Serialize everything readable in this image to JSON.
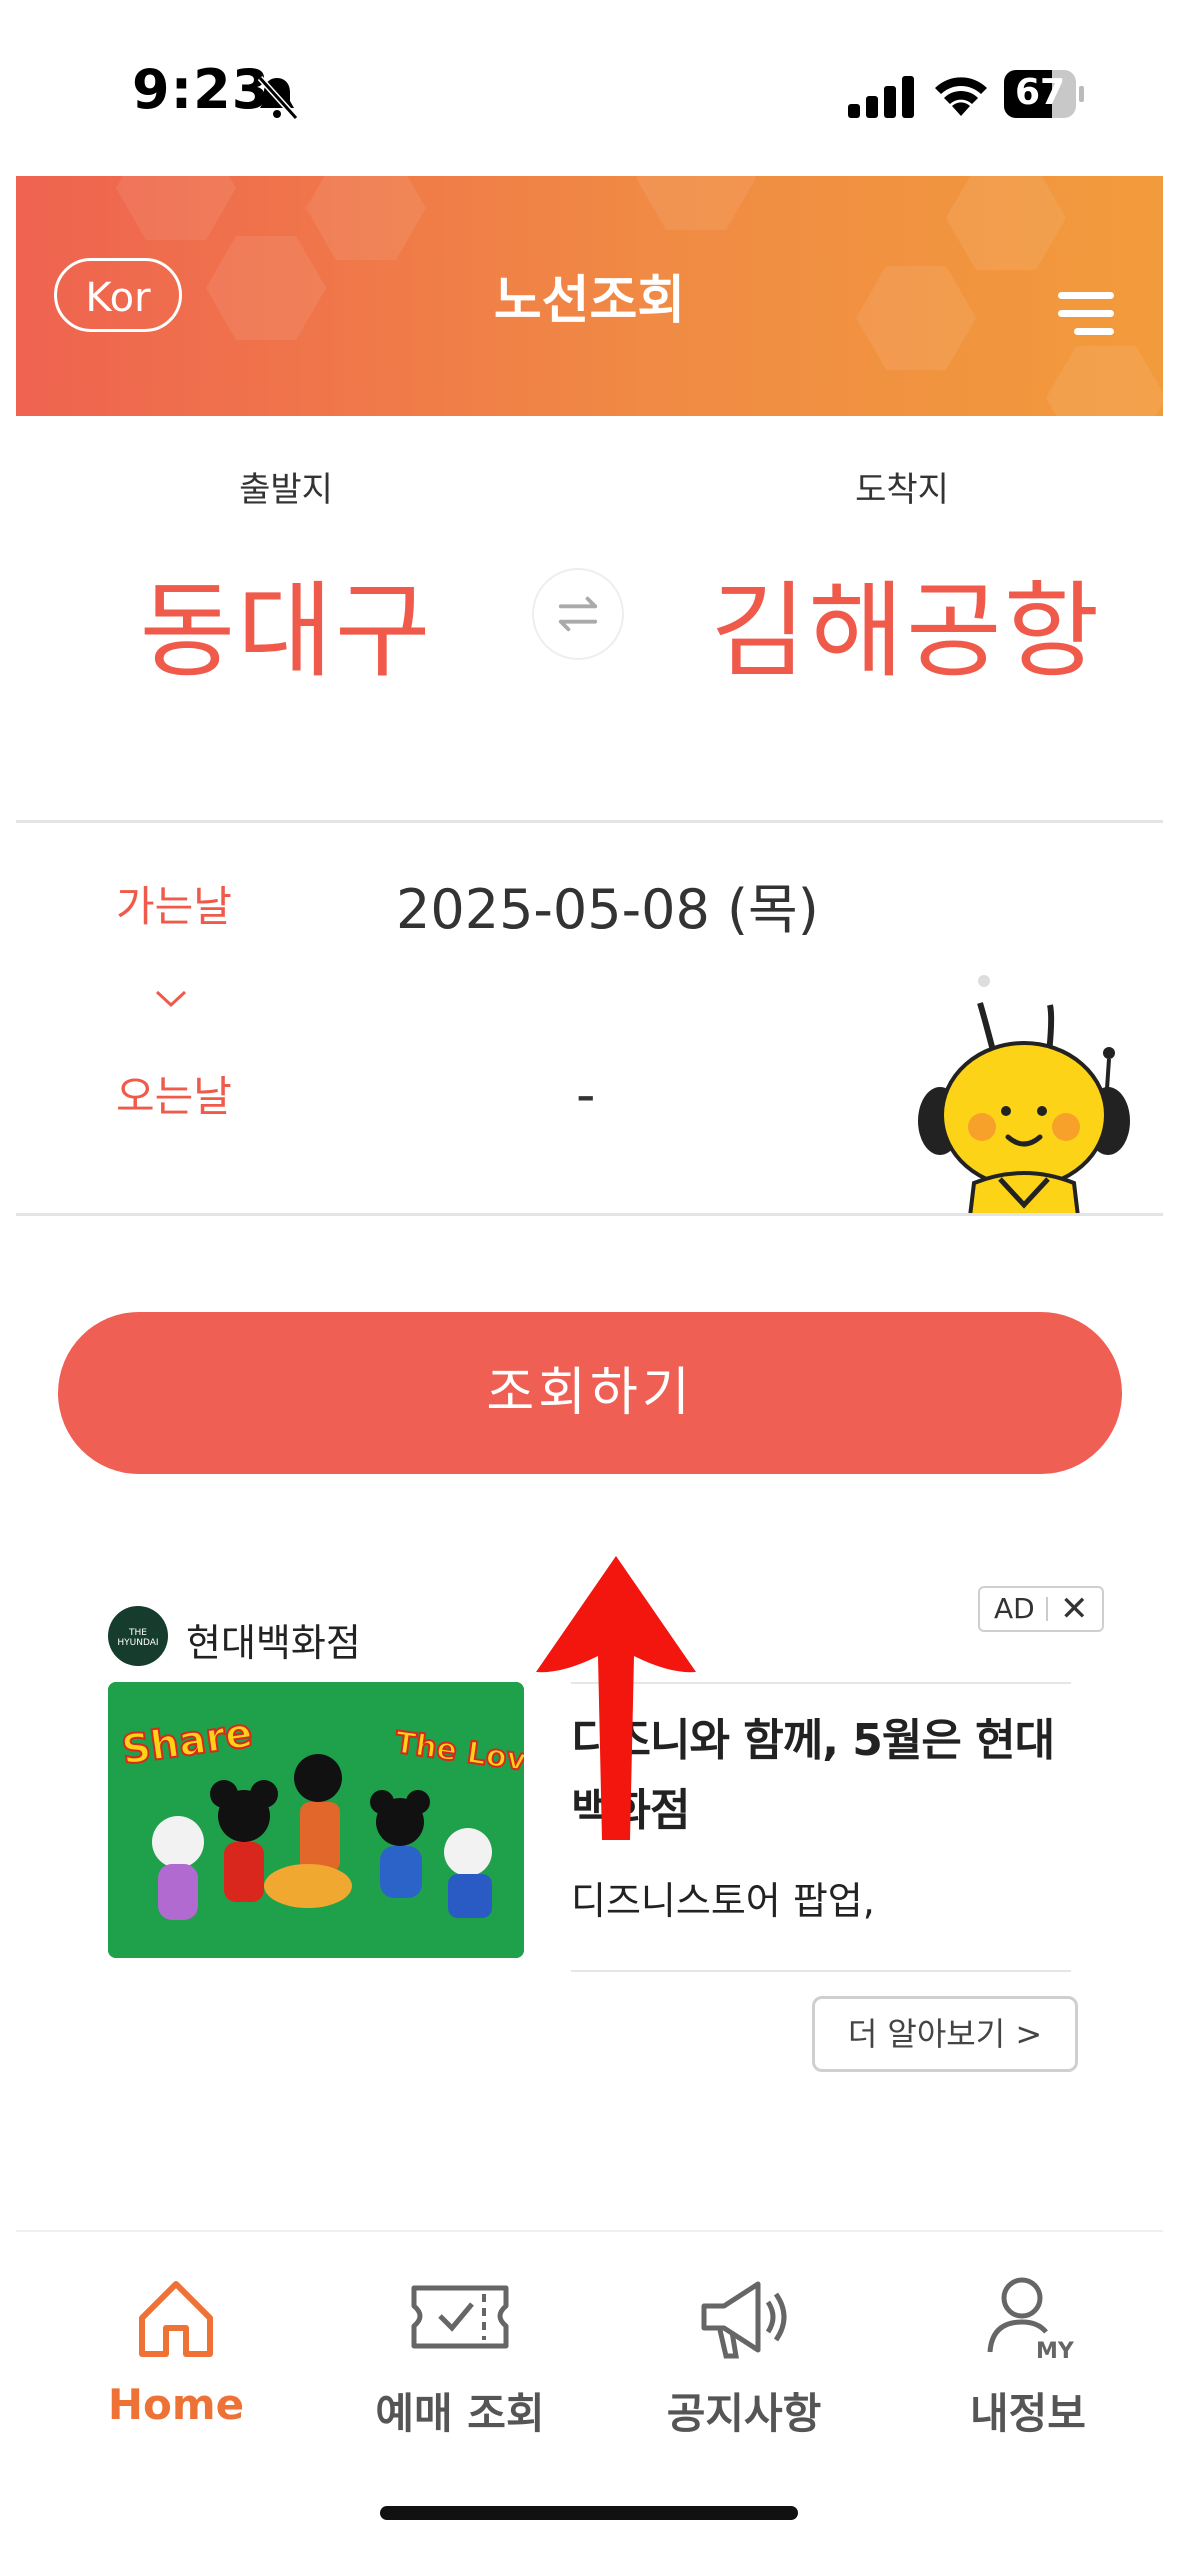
{
  "status_bar": {
    "time": "9:23",
    "battery": "67",
    "battery_level": 0.67
  },
  "header": {
    "language": "Kor",
    "title": "노선조회"
  },
  "route": {
    "departure_label": "출발지",
    "departure": "동대구",
    "arrival_label": "도착지",
    "arrival": "김해공항"
  },
  "dates": {
    "go_label": "가는날",
    "go_value": "2025-05-08 (목)",
    "return_label": "오는날",
    "return_value": "-"
  },
  "search_button": "조회하기",
  "ad": {
    "badge": "AD",
    "brand": "현대백화점",
    "logo_text": "THE HYUNDAI",
    "title": "디즈니와 함께, 5월은 현대백화점",
    "desc": "디즈니스토어 팝업,",
    "more": "더 알아보기 >",
    "image_text_left": "Share",
    "image_text_right": "The Love"
  },
  "nav": [
    {
      "label": "Home",
      "icon": "home-icon",
      "active": true
    },
    {
      "label": "예매 조회",
      "icon": "ticket-icon",
      "active": false
    },
    {
      "label": "공지사항",
      "icon": "megaphone-icon",
      "active": false
    },
    {
      "label": "내정보",
      "icon": "my-profile-icon",
      "active": false
    }
  ],
  "colors": {
    "accent": "#ef5a4b",
    "header_start": "#ef6350",
    "header_end": "#f29b3c",
    "nav_active": "#ee7236"
  }
}
